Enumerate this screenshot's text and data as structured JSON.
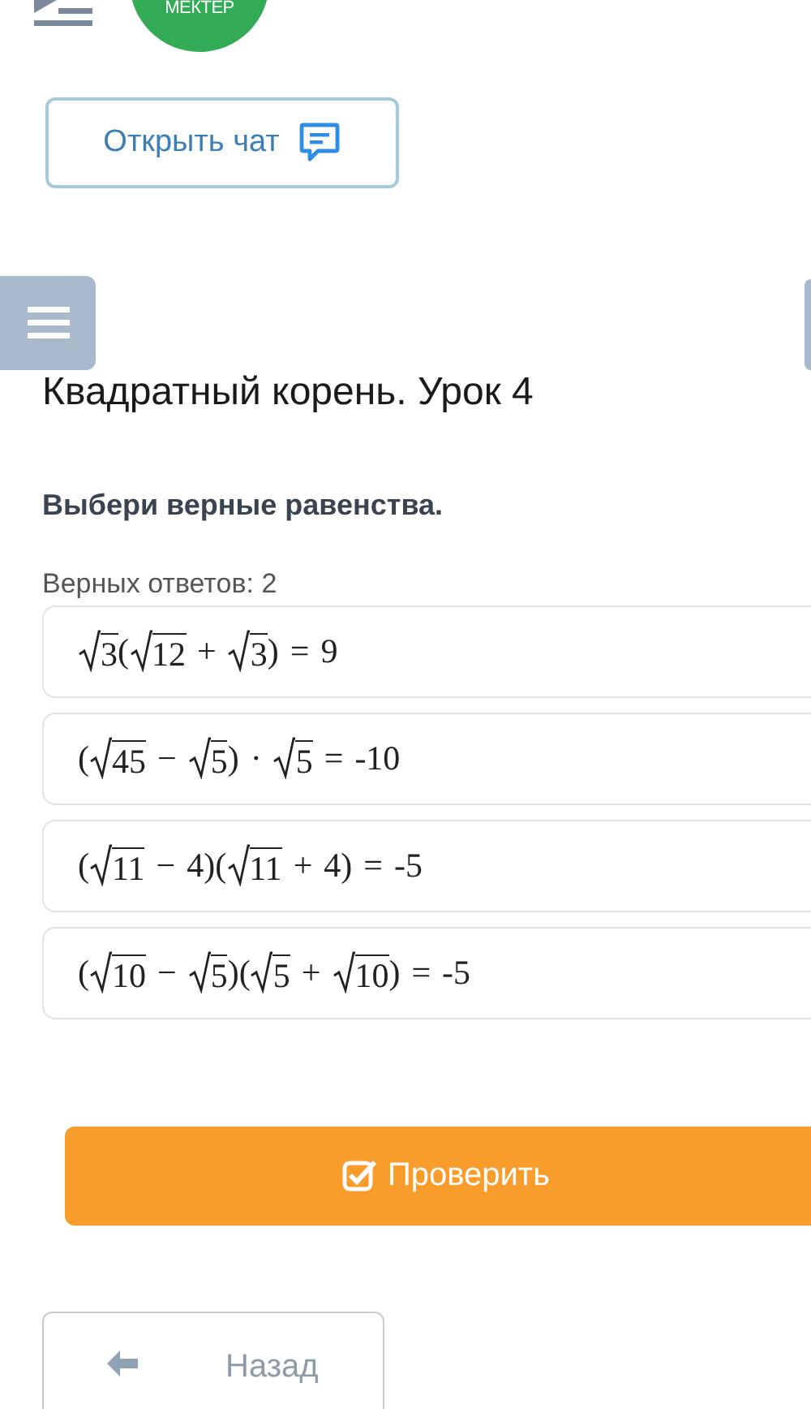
{
  "header": {
    "logo": "МЕКТЕР"
  },
  "chat_button": {
    "label": "Открыть чат"
  },
  "lesson_title": "Квадратный корень. Урок 4",
  "question": "Выбери верные равенства.",
  "answers_count": "Верных ответов: 2",
  "options": [
    {
      "selected": false,
      "parts": [
        {
          "kind": "sqrt",
          "text": "3"
        },
        {
          "kind": "text",
          "text": "("
        },
        {
          "kind": "sqrt",
          "text": "12"
        },
        {
          "kind": "op",
          "text": "+"
        },
        {
          "kind": "sqrt",
          "text": "3"
        },
        {
          "kind": "text",
          "text": ")"
        },
        {
          "kind": "op",
          "text": "="
        },
        {
          "kind": "text",
          "text": "9"
        }
      ]
    },
    {
      "selected": false,
      "parts": [
        {
          "kind": "text",
          "text": "("
        },
        {
          "kind": "sqrt",
          "text": "45"
        },
        {
          "kind": "op",
          "text": "−"
        },
        {
          "kind": "sqrt",
          "text": "5"
        },
        {
          "kind": "text",
          "text": ")"
        },
        {
          "kind": "op",
          "text": "·"
        },
        {
          "kind": "sqrt",
          "text": "5"
        },
        {
          "kind": "op",
          "text": "="
        },
        {
          "kind": "text",
          "text": "-10"
        }
      ]
    },
    {
      "selected": false,
      "parts": [
        {
          "kind": "text",
          "text": "("
        },
        {
          "kind": "sqrt",
          "text": "11"
        },
        {
          "kind": "op",
          "text": "−"
        },
        {
          "kind": "text",
          "text": "4)("
        },
        {
          "kind": "sqrt",
          "text": "11"
        },
        {
          "kind": "op",
          "text": "+"
        },
        {
          "kind": "text",
          "text": "4)"
        },
        {
          "kind": "op",
          "text": "="
        },
        {
          "kind": "text",
          "text": "-5"
        }
      ]
    },
    {
      "selected": false,
      "parts": [
        {
          "kind": "text",
          "text": "("
        },
        {
          "kind": "sqrt",
          "text": "10"
        },
        {
          "kind": "op",
          "text": "−"
        },
        {
          "kind": "sqrt",
          "text": "5"
        },
        {
          "kind": "text",
          "text": ")("
        },
        {
          "kind": "sqrt",
          "text": "5"
        },
        {
          "kind": "op",
          "text": "+"
        },
        {
          "kind": "sqrt",
          "text": "10"
        },
        {
          "kind": "text",
          "text": ")"
        },
        {
          "kind": "op",
          "text": "="
        },
        {
          "kind": "text",
          "text": "-5"
        }
      ]
    }
  ],
  "check_button": {
    "label": "Проверить"
  },
  "back_button": {
    "label": "Назад"
  }
}
